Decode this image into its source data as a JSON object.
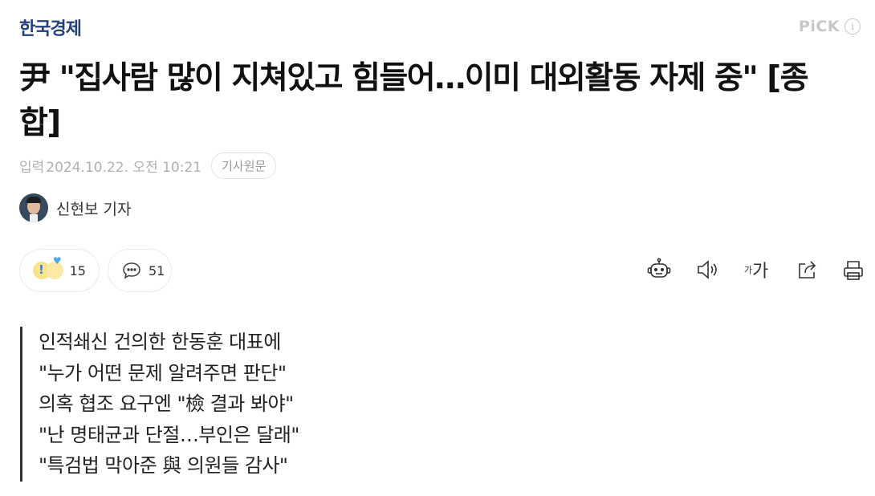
{
  "header": {
    "press_name": "한국경제",
    "pick_label": "PiCK",
    "pick_info": "i"
  },
  "article": {
    "title": "尹 \"집사람 많이 지쳐있고 힘들어…이미 대외활동 자제 중\" [종합]",
    "meta": {
      "label": "입력",
      "date": "2024.10.22. 오전 10:21",
      "original_link_label": "기사원문"
    },
    "reporter": {
      "name": "신현보 기자"
    },
    "reactions": {
      "reaction_count": "15",
      "comment_count": "51"
    },
    "summary": [
      "인적쇄신 건의한 한동훈 대표에",
      "\"누가 어떤 문제 알려주면 판단\"",
      "의혹 협조 요구엔 \"檢 결과 봐야\"",
      "\"난 명태균과 단절…부인은 달래\"",
      "\"특검법 막아준 與 의원들 감사\""
    ]
  },
  "toolbar": {
    "font_size_small": "가",
    "font_size_large": "가",
    "icons": [
      "summary-bot-icon",
      "speaker-icon",
      "font-size-icon",
      "share-icon",
      "print-icon"
    ]
  },
  "colors": {
    "press_logo": "#24407a",
    "muted": "#b0b0b0",
    "title": "#111111"
  }
}
